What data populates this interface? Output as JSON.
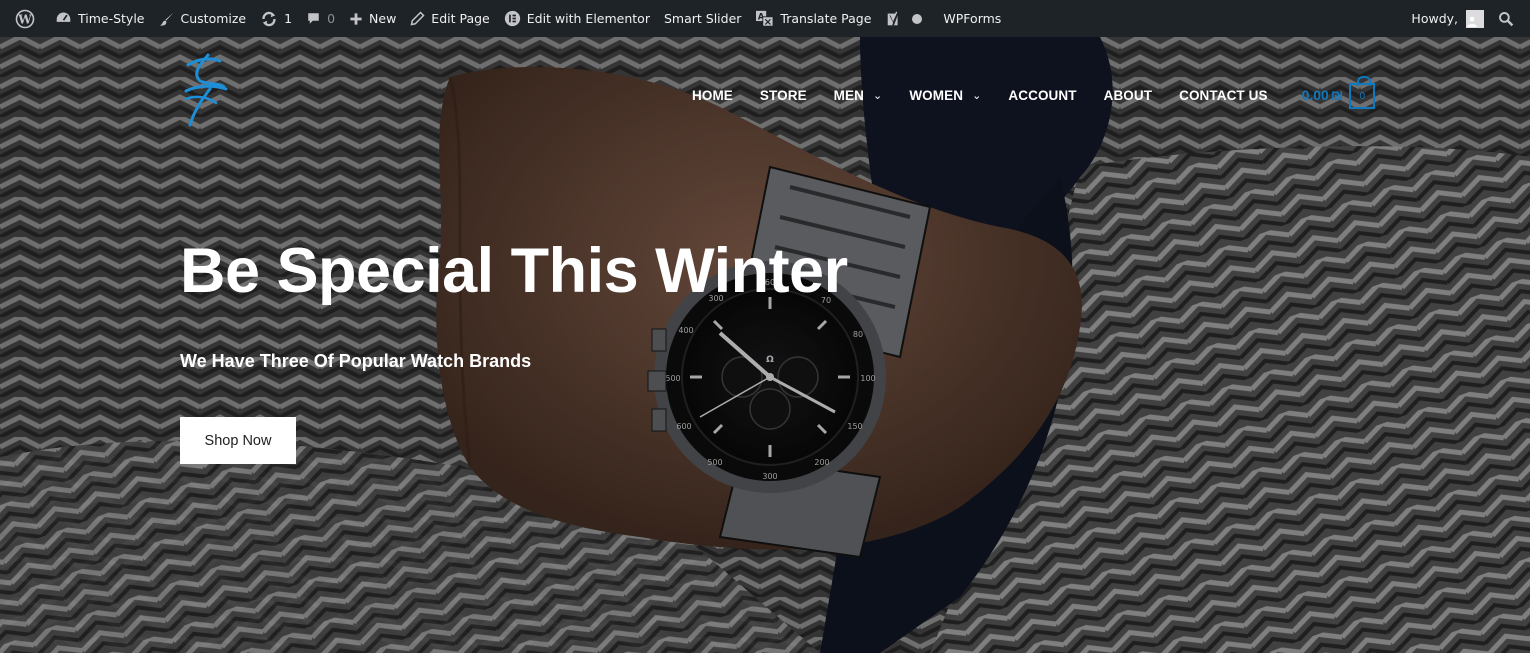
{
  "admin_bar": {
    "items": [
      {
        "name": "wp-logo",
        "icon": "wordpress-icon",
        "label": ""
      },
      {
        "name": "site-name",
        "icon": "dashboard-icon",
        "label": "Time-Style"
      },
      {
        "name": "customize",
        "icon": "brush-icon",
        "label": "Customize"
      },
      {
        "name": "updates",
        "icon": "update-icon",
        "label": "1"
      },
      {
        "name": "comments",
        "icon": "comment-icon",
        "label": "0"
      },
      {
        "name": "new-content",
        "icon": "plus-icon",
        "label": "New"
      },
      {
        "name": "edit-page",
        "icon": "pencil-icon",
        "label": "Edit Page"
      },
      {
        "name": "elementor",
        "icon": "elementor-icon",
        "label": "Edit with Elementor"
      },
      {
        "name": "smart-slider",
        "icon": "",
        "label": "Smart Slider"
      },
      {
        "name": "translate-page",
        "icon": "translate-icon",
        "label": "Translate Page"
      },
      {
        "name": "yoast",
        "icon": "yoast-icon",
        "label": ""
      },
      {
        "name": "wpforms",
        "icon": "status-dot-icon",
        "label": "WPForms"
      }
    ],
    "howdy": "Howdy,",
    "background": "#1d2327"
  },
  "header": {
    "logo_icon": "brand-logo-icon",
    "nav": [
      {
        "label": "HOME",
        "dropdown": false
      },
      {
        "label": "STORE",
        "dropdown": false
      },
      {
        "label": "MEN",
        "dropdown": true
      },
      {
        "label": "WOMEN",
        "dropdown": true
      },
      {
        "label": "ACCOUNT",
        "dropdown": false
      },
      {
        "label": "ABOUT",
        "dropdown": false
      },
      {
        "label": "CONTACT US",
        "dropdown": false
      }
    ],
    "cart_total": "0.00",
    "cart_currency": "₪",
    "cart_count": "0",
    "accent_color": "#0e79bf"
  },
  "hero": {
    "title": "Be Special This Winter",
    "subtitle": "We Have Three Of Popular Watch Brands",
    "button_label": "Shop Now"
  }
}
